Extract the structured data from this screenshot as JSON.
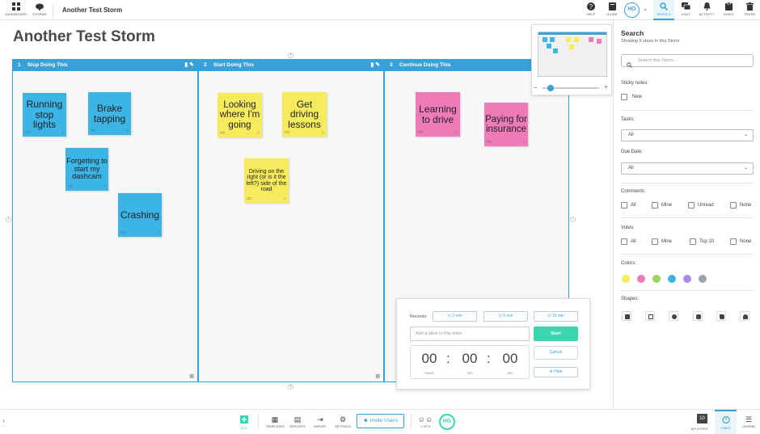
{
  "topbar": {
    "dashboard": "DASHBOARD",
    "storms": "STORMS",
    "storm_title": "Another Test Storm",
    "help": "HELP",
    "guide": "GUIDE",
    "avatar": "HG",
    "search": "SEARCH",
    "chat": "CHAT",
    "activity": "ACTIVITY",
    "tasks": "TASKS",
    "trash": "TRASH"
  },
  "canvas": {
    "title": "Another Test Storm",
    "columns": [
      {
        "num": "1",
        "title": "Stop Doing This"
      },
      {
        "num": "2",
        "title": "Start Doing This"
      },
      {
        "num": "3",
        "title": "Continue Doing This"
      }
    ],
    "notes": [
      {
        "text": "Running stop lights",
        "color": "blue"
      },
      {
        "text": "Brake tapping",
        "color": "blue"
      },
      {
        "text": "Forgetting to start my dashcam",
        "color": "blue"
      },
      {
        "text": "Crashing",
        "color": "blue"
      },
      {
        "text": "Looking where I'm going",
        "color": "yellow"
      },
      {
        "text": "Get driving lessons",
        "color": "yellow"
      },
      {
        "text": "Driving on the right (or is it the left?) side of the road",
        "color": "yellow"
      },
      {
        "text": "Learning to drive",
        "color": "pink"
      },
      {
        "text": "Paying for insurance",
        "color": "pink"
      }
    ]
  },
  "timer": {
    "recents_label": "Recents:",
    "recent_1": "2 min",
    "recent_2": "5 min",
    "recent_3": "10 min",
    "label_placeholder": "Add a label to this timer",
    "start": "Start",
    "cancel": "Cancel",
    "hide": "Hide",
    "hours": "00",
    "min": "00",
    "sec": "00",
    "hours_label": "hours",
    "min_label": "min",
    "sec_label": "sec"
  },
  "search_panel": {
    "title": "Search",
    "subtitle": "Showing 9 ideas in this Storm",
    "search_placeholder": "Search this Storm...",
    "sticky_label": "Sticky notes:",
    "sticky_new": "New",
    "tasks_label": "Tasks:",
    "tasks_value": "All",
    "due_label": "Due Date:",
    "due_value": "All",
    "comments_label": "Comments:",
    "comments_opts": [
      "All",
      "Mine",
      "Unread",
      "None"
    ],
    "votes_label": "Votes:",
    "votes_opts": [
      "All",
      "Mine",
      "Top 10",
      "None"
    ],
    "colors_label": "Colors:",
    "colors": [
      "#f6ea5d",
      "#ee7ab8",
      "#9bd45c",
      "#3cb4e6",
      "#a98be8",
      "#9aa5ad"
    ],
    "shapes_label": "Shapes:"
  },
  "bottombar": {
    "add": "ADD",
    "templates": "TEMPLATES",
    "reports": "REPORTS",
    "import": "IMPORT",
    "settings": "SETTINGS",
    "invite": "Invite Users",
    "users_count": "1 OF 5",
    "avatar": "HG",
    "my_votes_count": "10",
    "my_votes": "MY VOTES",
    "timer": "TIMER",
    "legend": "LEGEND"
  }
}
